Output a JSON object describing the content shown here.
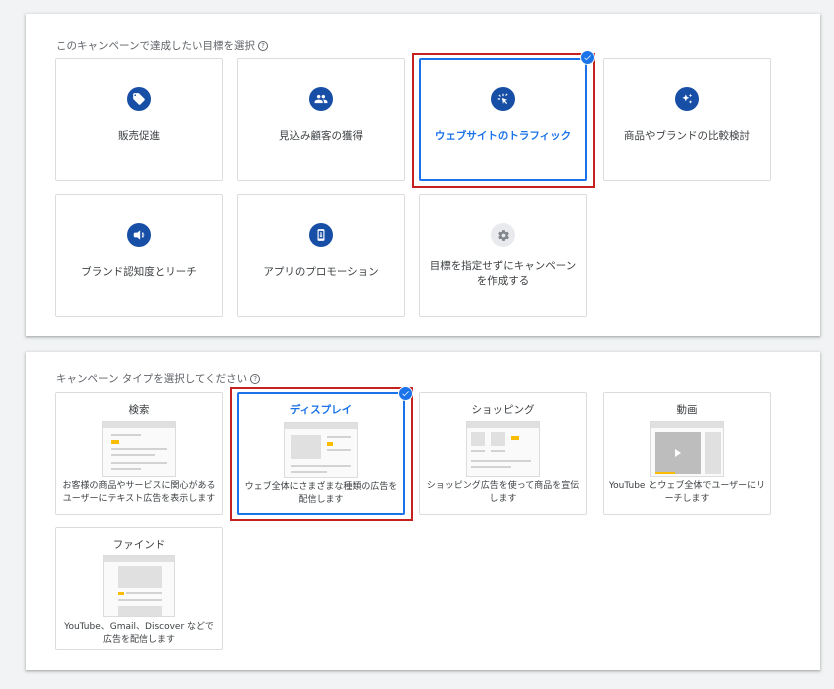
{
  "goals_section": {
    "title": "このキャンペーンで達成したい目標を選択",
    "help": "?",
    "goals": [
      {
        "label": "販売促進",
        "icon": "tag-icon",
        "selected": false
      },
      {
        "label": "見込み顧客の獲得",
        "icon": "people-icon",
        "selected": false
      },
      {
        "label": "ウェブサイトのトラフィック",
        "icon": "cursor-click-icon",
        "selected": true
      },
      {
        "label": "商品やブランドの比較検討",
        "icon": "sparkle-icon",
        "selected": false
      },
      {
        "label": "ブランド認知度とリーチ",
        "icon": "megaphone-icon",
        "selected": false
      },
      {
        "label": "アプリのプロモーション",
        "icon": "phone-icon",
        "selected": false
      },
      {
        "label": "目標を指定せずにキャンペーンを作成する",
        "icon": "gear-icon",
        "selected": false
      }
    ]
  },
  "types_section": {
    "title": "キャンペーン タイプを選択してください",
    "help": "?",
    "types": [
      {
        "title": "検索",
        "description": "お客様の商品やサービスに関心があるユーザーにテキスト広告を表示します",
        "thumbnail": "search-thumbnail",
        "selected": false
      },
      {
        "title": "ディスプレイ",
        "description": "ウェブ全体にさまざまな種類の広告を配信します",
        "thumbnail": "display-thumbnail",
        "selected": true
      },
      {
        "title": "ショッピング",
        "description": "ショッピング広告を使って商品を宣伝します",
        "thumbnail": "shopping-thumbnail",
        "selected": false
      },
      {
        "title": "動画",
        "description": "YouTube とウェブ全体でユーザーにリーチします",
        "thumbnail": "video-thumbnail",
        "selected": false
      },
      {
        "title": "ファインド",
        "description": "YouTube、Gmail、Discover などで広告を配信します",
        "thumbnail": "discover-thumbnail",
        "selected": false
      }
    ]
  },
  "colors": {
    "accent": "#1a73e8",
    "icon_bg": "#174ea6",
    "highlight_outline": "#c5221f",
    "thumbnail_accent": "#fbbc04"
  }
}
